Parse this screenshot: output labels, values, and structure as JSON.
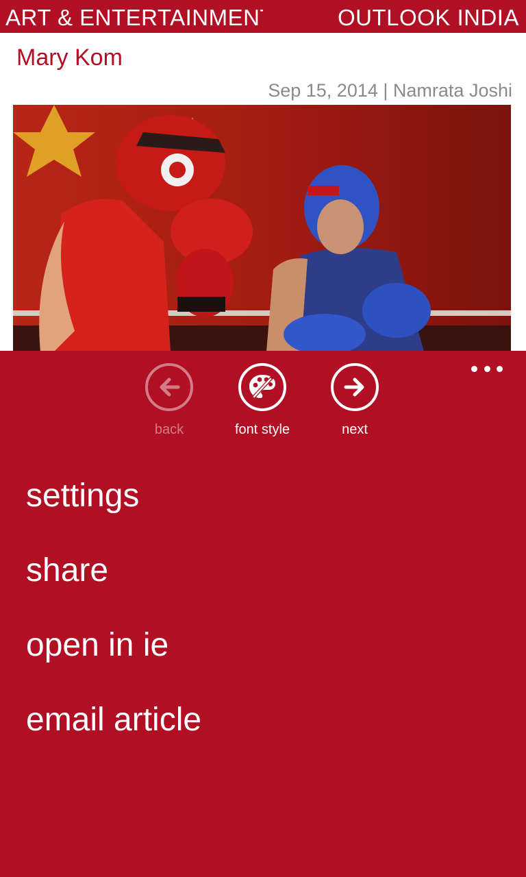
{
  "header": {
    "section": "ART & ENTERTAINMENT",
    "brand": "OUTLOOK INDIA"
  },
  "article": {
    "title": "Mary Kom",
    "date": "Sep 15, 2014",
    "separator": "|",
    "author": "Namrata Joshi",
    "image_description": "photo"
  },
  "appbar": {
    "buttons": [
      {
        "label": "back",
        "icon": "arrow-left-icon",
        "enabled": false
      },
      {
        "label": "font style",
        "icon": "palette-icon",
        "enabled": true
      },
      {
        "label": "next",
        "icon": "arrow-right-icon",
        "enabled": true
      }
    ],
    "menu": [
      "settings",
      "share",
      "open in ie",
      "email article"
    ]
  },
  "colors": {
    "accent": "#b00f24",
    "byline": "#8a8a8a"
  }
}
